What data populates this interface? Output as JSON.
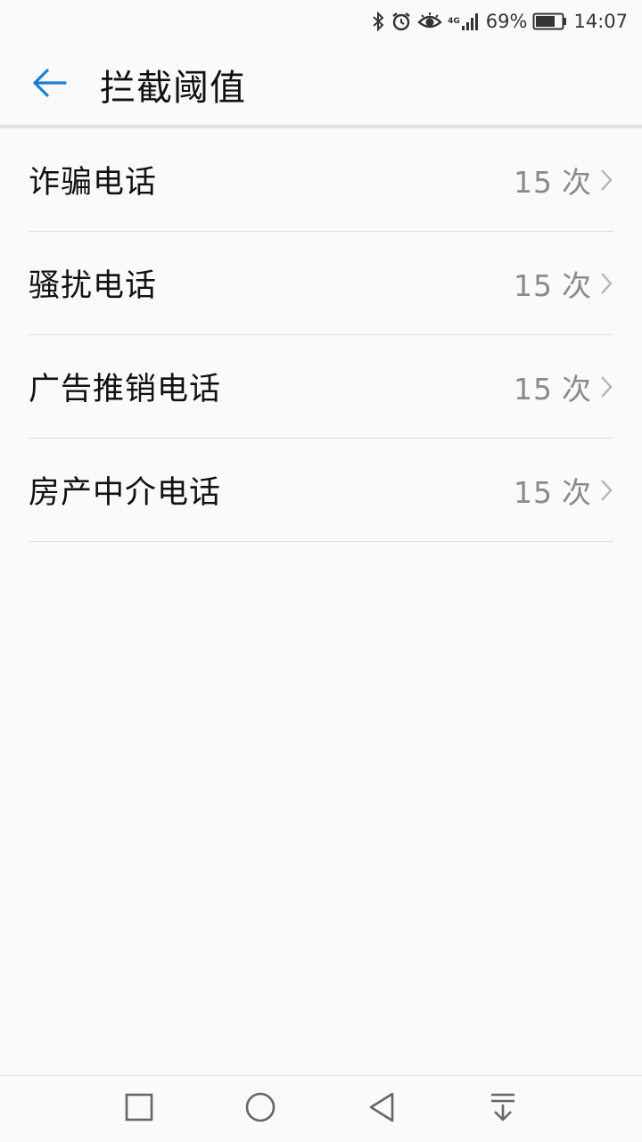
{
  "status_bar": {
    "network": "4G",
    "battery_percent": "69%",
    "time": "14:07",
    "icons": [
      "bluetooth-icon",
      "alarm-icon",
      "eye-comfort-icon",
      "signal-icon",
      "battery-icon"
    ]
  },
  "app_bar": {
    "back_icon": "arrow-left-icon",
    "title": "拦截阈值",
    "accent_color": "#1a7fd4"
  },
  "settings": {
    "items": [
      {
        "label": "诈骗电话",
        "value": "15",
        "unit": "次"
      },
      {
        "label": "骚扰电话",
        "value": "15",
        "unit": "次"
      },
      {
        "label": "广告推销电话",
        "value": "15",
        "unit": "次"
      },
      {
        "label": "房产中介电话",
        "value": "15",
        "unit": "次"
      }
    ]
  },
  "nav_bar": {
    "buttons": [
      "recents-square-icon",
      "home-circle-icon",
      "back-triangle-icon",
      "notification-pulldown-icon"
    ]
  }
}
